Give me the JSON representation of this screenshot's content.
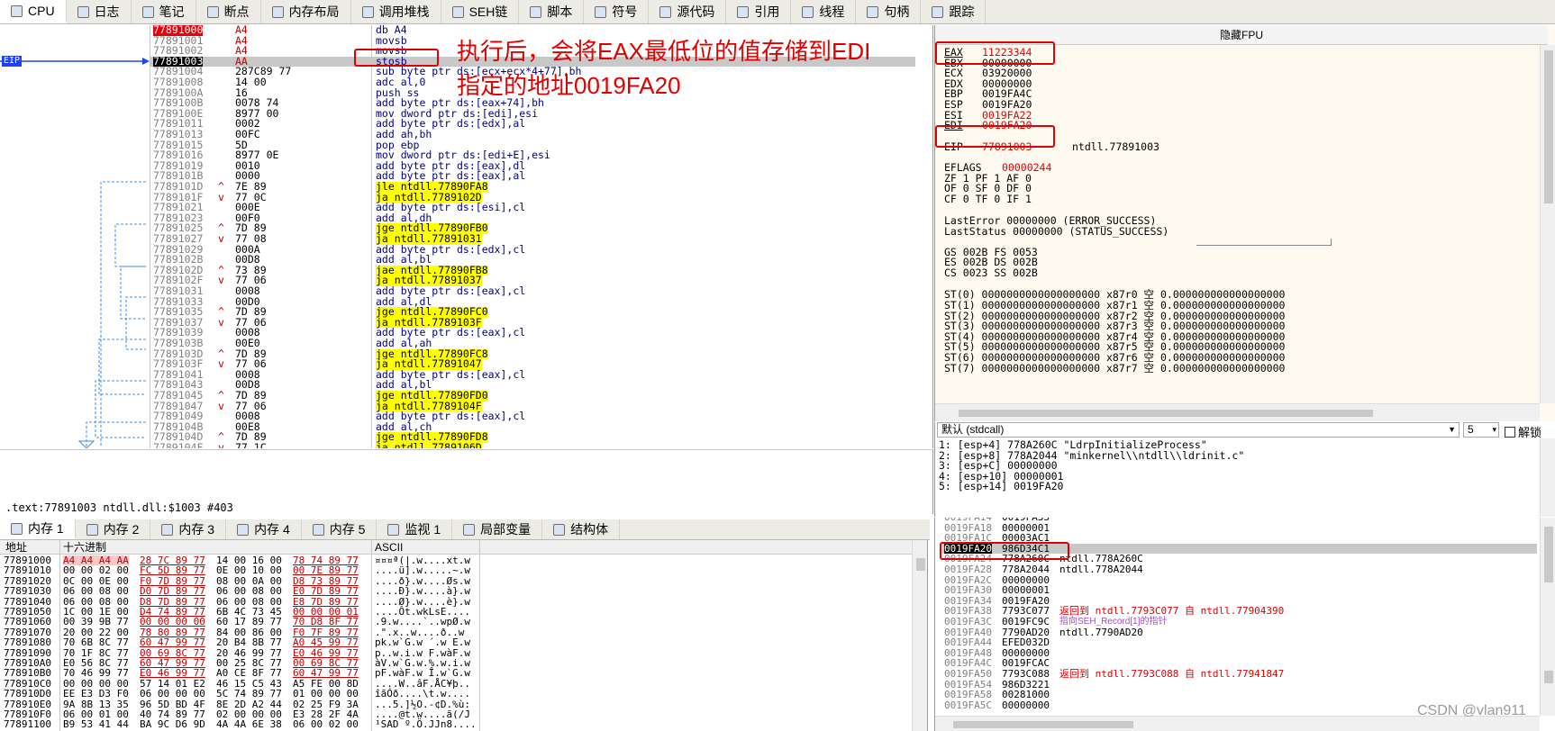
{
  "top_tabs": [
    {
      "label": "CPU",
      "icon": "cpu-icon",
      "active": true
    },
    {
      "label": "日志",
      "icon": "log-icon"
    },
    {
      "label": "笔记",
      "icon": "notes-icon"
    },
    {
      "label": "断点",
      "icon": "breakpoint-icon"
    },
    {
      "label": "内存布局",
      "icon": "memory-map-icon"
    },
    {
      "label": "调用堆栈",
      "icon": "call-stack-icon"
    },
    {
      "label": "SEH链",
      "icon": "seh-icon"
    },
    {
      "label": "脚本",
      "icon": "script-icon"
    },
    {
      "label": "符号",
      "icon": "symbols-icon"
    },
    {
      "label": "源代码",
      "icon": "source-icon"
    },
    {
      "label": "引用",
      "icon": "references-icon"
    },
    {
      "label": "线程",
      "icon": "threads-icon"
    },
    {
      "label": "句柄",
      "icon": "handles-icon"
    },
    {
      "label": "跟踪",
      "icon": "trace-icon"
    }
  ],
  "annotation": {
    "line1": "执行后，会将EAX最低位的值存储到EDI",
    "line2": "指定的地址0019FA20"
  },
  "eip_label": "EIP",
  "disasm": [
    {
      "addr": "77891000",
      "bytes": "A4",
      "instr": "db A4",
      "addr_style": "red",
      "bytes_red": true
    },
    {
      "addr": "77891001",
      "bytes": "A4",
      "instr": "movsb",
      "bytes_red": true
    },
    {
      "addr": "77891002",
      "bytes": "A4",
      "instr": "movsb",
      "bytes_red": true
    },
    {
      "addr": "77891003",
      "bytes": "AA",
      "instr": "stosb",
      "current": true,
      "bytes_red": true
    },
    {
      "addr": "77891004",
      "bytes": "287C89 77",
      "instr": "sub byte ptr ds:[ecx+ecx*4+77],bh"
    },
    {
      "addr": "77891008",
      "bytes": "14 00",
      "instr": "adc al,0"
    },
    {
      "addr": "7789100A",
      "bytes": "16",
      "instr": "push ss"
    },
    {
      "addr": "7789100B",
      "bytes": "0078 74",
      "instr": "add byte ptr ds:[eax+74],bh"
    },
    {
      "addr": "7789100E",
      "bytes": "8977 00",
      "instr": "mov dword ptr ds:[edi],esi"
    },
    {
      "addr": "77891011",
      "bytes": "0002",
      "instr": "add byte ptr ds:[edx],al"
    },
    {
      "addr": "77891013",
      "bytes": "00FC",
      "instr": "add ah,bh"
    },
    {
      "addr": "77891015",
      "bytes": "5D",
      "instr": "pop ebp"
    },
    {
      "addr": "77891016",
      "bytes": "8977 0E",
      "instr": "mov dword ptr ds:[edi+E],esi"
    },
    {
      "addr": "77891019",
      "bytes": "0010",
      "instr": "add byte ptr ds:[eax],dl"
    },
    {
      "addr": "7789101B",
      "bytes": "0000",
      "instr": "add byte ptr ds:[eax],al"
    },
    {
      "addr": "7789101D",
      "bytes": "7E 89",
      "instr": "jle ntdll.77890FA8",
      "jump": true,
      "arrow": "^"
    },
    {
      "addr": "7789101F",
      "bytes": "77 0C",
      "instr": "ja ntdll.7789102D",
      "jump": true,
      "arrow": "v"
    },
    {
      "addr": "77891021",
      "bytes": "000E",
      "instr": "add byte ptr ds:[esi],cl"
    },
    {
      "addr": "77891023",
      "bytes": "00F0",
      "instr": "add al,dh"
    },
    {
      "addr": "77891025",
      "bytes": "7D 89",
      "instr": "jge ntdll.77890FB0",
      "jump": true,
      "arrow": "^"
    },
    {
      "addr": "77891027",
      "bytes": "77 08",
      "instr": "ja ntdll.77891031",
      "jump": true,
      "arrow": "v"
    },
    {
      "addr": "77891029",
      "bytes": "000A",
      "instr": "add byte ptr ds:[edx],cl"
    },
    {
      "addr": "7789102B",
      "bytes": "00D8",
      "instr": "add al,bl"
    },
    {
      "addr": "7789102D",
      "bytes": "73 89",
      "instr": "jae ntdll.77890FB8",
      "jump": true,
      "arrow": "^"
    },
    {
      "addr": "7789102F",
      "bytes": "77 06",
      "instr": "ja ntdll.77891037",
      "jump": true,
      "arrow": "v"
    },
    {
      "addr": "77891031",
      "bytes": "0008",
      "instr": "add byte ptr ds:[eax],cl"
    },
    {
      "addr": "77891033",
      "bytes": "00D0",
      "instr": "add al,dl"
    },
    {
      "addr": "77891035",
      "bytes": "7D 89",
      "instr": "jge ntdll.77890FC0",
      "jump": true,
      "arrow": "^"
    },
    {
      "addr": "77891037",
      "bytes": "77 06",
      "instr": "ja ntdll.7789103F",
      "jump": true,
      "arrow": "v"
    },
    {
      "addr": "77891039",
      "bytes": "0008",
      "instr": "add byte ptr ds:[eax],cl"
    },
    {
      "addr": "7789103B",
      "bytes": "00E0",
      "instr": "add al,ah"
    },
    {
      "addr": "7789103D",
      "bytes": "7D 89",
      "instr": "jge ntdll.77890FC8",
      "jump": true,
      "arrow": "^"
    },
    {
      "addr": "7789103F",
      "bytes": "77 06",
      "instr": "ja ntdll.77891047",
      "jump": true,
      "arrow": "v"
    },
    {
      "addr": "77891041",
      "bytes": "0008",
      "instr": "add byte ptr ds:[eax],cl"
    },
    {
      "addr": "77891043",
      "bytes": "00D8",
      "instr": "add al,bl"
    },
    {
      "addr": "77891045",
      "bytes": "7D 89",
      "instr": "jge ntdll.77890FD0",
      "jump": true,
      "arrow": "^"
    },
    {
      "addr": "77891047",
      "bytes": "77 06",
      "instr": "ja ntdll.7789104F",
      "jump": true,
      "arrow": "v"
    },
    {
      "addr": "77891049",
      "bytes": "0008",
      "instr": "add byte ptr ds:[eax],cl"
    },
    {
      "addr": "7789104B",
      "bytes": "00E8",
      "instr": "add al,ch"
    },
    {
      "addr": "7789104D",
      "bytes": "7D 89",
      "instr": "jge ntdll.77890FD8",
      "jump": true,
      "arrow": "^"
    },
    {
      "addr": "7789104F",
      "bytes": "77 1C",
      "instr": "ja ntdll.7789106D",
      "jump": true,
      "arrow": "v"
    }
  ],
  "status_line": ".text:77891003 ntdll.dll:$1003 #403",
  "fpu_header": "隐藏FPU",
  "registers": [
    {
      "name": "EAX",
      "value": "11223344",
      "changed": true
    },
    {
      "name": "EBX",
      "value": "00000000"
    },
    {
      "name": "ECX",
      "value": "03920000"
    },
    {
      "name": "EDX",
      "value": "00000000"
    },
    {
      "name": "EBP",
      "value": "0019FA4C"
    },
    {
      "name": "ESP",
      "value": "0019FA20"
    },
    {
      "name": "ESI",
      "value": "0019FA22",
      "changed": true
    },
    {
      "name": "EDI",
      "value": "0019FA20",
      "changed": true
    }
  ],
  "eip_reg": {
    "name": "EIP",
    "value": "77891003",
    "comment": "ntdll.77891003"
  },
  "eflags": {
    "name": "EFLAGS",
    "value": "00000244"
  },
  "flags_lines": [
    "ZF 1  PF 1  AF 0",
    "OF 0  SF 0  DF 0",
    "CF 0  TF 0  IF 1"
  ],
  "last_error": "LastError  00000000 (ERROR_SUCCESS)",
  "last_status": "LastStatus 00000000 (STATUS_SUCCESS)",
  "segments": [
    "GS 002B  FS 0053",
    "ES 002B  DS 002B",
    "CS 0023  SS 002B"
  ],
  "fpu": [
    "ST(0) 0000000000000000000 x87r0 空 0.000000000000000000",
    "ST(1) 0000000000000000000 x87r1 空 0.000000000000000000",
    "ST(2) 0000000000000000000 x87r2 空 0.000000000000000000",
    "ST(3) 0000000000000000000 x87r3 空 0.000000000000000000",
    "ST(4) 0000000000000000000 x87r4 空 0.000000000000000000",
    "ST(5) 0000000000000000000 x87r5 空 0.000000000000000000",
    "ST(6) 0000000000000000000 x87r6 空 0.000000000000000000",
    "ST(7) 0000000000000000000 x87r7 空 0.000000000000000000"
  ],
  "callconv": {
    "label": "默认 (stdcall)",
    "count": "5",
    "unlock_label": "解锁"
  },
  "params": [
    "1: [esp+4] 778A260C \"LdrpInitializeProcess\"",
    "2: [esp+8] 778A2044 \"minkernel\\\\ntdll\\\\ldrinit.c\"",
    "3: [esp+C] 00000000",
    "4: [esp+10] 00000001",
    "5: [esp+14] 0019FA20"
  ],
  "mem_tabs": [
    {
      "label": "内存 1",
      "icon": "memory-icon",
      "active": true
    },
    {
      "label": "内存 2",
      "icon": "memory-icon"
    },
    {
      "label": "内存 3",
      "icon": "memory-icon"
    },
    {
      "label": "内存 4",
      "icon": "memory-icon"
    },
    {
      "label": "内存 5",
      "icon": "memory-icon"
    },
    {
      "label": "监视 1",
      "icon": "watch-icon"
    },
    {
      "label": "局部变量",
      "icon": "locals-icon"
    },
    {
      "label": "结构体",
      "icon": "struct-icon"
    }
  ],
  "mem_headers": {
    "addr": "地址",
    "hex": "十六进制",
    "ascii": "ASCII"
  },
  "mem_rows": [
    {
      "addr": "77891000",
      "hex": [
        "A4 A4 A4 AA",
        "28 7C 89 77",
        "14 00 16 00",
        "78 74 89 77"
      ],
      "ascii": "¤¤¤ª(|.w....xt.w"
    },
    {
      "addr": "77891010",
      "hex": [
        "00 00 02 00",
        "FC 5D 89 77",
        "0E 00 10 00",
        "00 7E 89 77"
      ],
      "ascii": "....ü].w.....~.w"
    },
    {
      "addr": "77891020",
      "hex": [
        "0C 00 0E 00",
        "F0 7D 89 77",
        "08 00 0A 00",
        "D8 73 89 77"
      ],
      "ascii": "....ð}.w....Øs.w"
    },
    {
      "addr": "77891030",
      "hex": [
        "06 00 08 00",
        "D0 7D 89 77",
        "06 00 08 00",
        "E0 7D 89 77"
      ],
      "ascii": "....Ð}.w....à}.w"
    },
    {
      "addr": "77891040",
      "hex": [
        "06 00 08 00",
        "D8 7D 89 77",
        "06 00 08 00",
        "E8 7D 89 77"
      ],
      "ascii": "....Ø}.w....è}.w"
    },
    {
      "addr": "77891050",
      "hex": [
        "1C 00 1E 00",
        "D4 74 89 77",
        "6B 4C 73 45",
        "00 00 00 01"
      ],
      "ascii": "....Ôt.wkLsE...."
    },
    {
      "addr": "77891060",
      "hex": [
        "00 39 9B 77",
        "00 00 00 00",
        "60 17 89 77",
        "70 D8 8F 77"
      ],
      "ascii": ".9.w....`..wpØ.w"
    },
    {
      "addr": "77891070",
      "hex": [
        "20 00 22 00",
        "78 80 89 77",
        "84 00 86 00",
        "F0 7F 89 77"
      ],
      "ascii": " .\".x..w....ð..w"
    },
    {
      "addr": "77891080",
      "hex": [
        "70 6B 8C 77",
        "60 47 99 77",
        "20 B4 8B 77",
        "A0 45 99 77"
      ],
      "ascii": "pk.w`G.w ´.w E.w"
    },
    {
      "addr": "77891090",
      "hex": [
        "70 1F 8C 77",
        "00 69 8C 77",
        "20 46 99 77",
        "E0 46 99 77"
      ],
      "ascii": "p..w.i.w F.wàF.w"
    },
    {
      "addr": "778910A0",
      "hex": [
        "E0 56 8C 77",
        "60 47 99 77",
        "00 25 8C 77",
        "00 69 8C 77"
      ],
      "ascii": "àV.w`G.w.%.w.i.w"
    },
    {
      "addr": "778910B0",
      "hex": [
        "70 46 99 77",
        "E0 46 99 77",
        "A0 CE 8F 77",
        "60 47 99 77"
      ],
      "ascii": "pF.wàF.w Î.w`G.w"
    },
    {
      "addr": "778910C0",
      "hex": [
        "00 00 00 00",
        "57 14 01 E2",
        "46 15 C5 43",
        "A5 FE 00 8D"
      ],
      "ascii": "....W..âF.ÅC¥þ.."
    },
    {
      "addr": "778910D0",
      "hex": [
        "EE E3 D3 F0",
        "06 00 00 00",
        "5C 74 89 77",
        "01 00 00 00"
      ],
      "ascii": "îãÓð....\\t.w...."
    },
    {
      "addr": "778910E0",
      "hex": [
        "9A 8B 13 35",
        "96 5D BD 4F",
        "8E 2D A2 44",
        "02 25 F9 3A"
      ],
      "ascii": "...5.]½O.-¢D.%ù:"
    },
    {
      "addr": "778910F0",
      "hex": [
        "06 00 01 00",
        "40 74 89 77",
        "02 00 00 00",
        "E3 28 2F 4A"
      ],
      "ascii": "....@t.w....ã(/J"
    },
    {
      "addr": "77891100",
      "hex": [
        "B9 53 41 44",
        "BA 9C D6 9D",
        "4A 4A 6E 38",
        "06 00 02 00"
      ],
      "ascii": "¹SAD º.Ö.JJn8...."
    }
  ],
  "stack_rows": [
    {
      "addr": "0019FA14",
      "value": "0019FA33",
      "comment": ""
    },
    {
      "addr": "0019FA18",
      "value": "00000001",
      "comment": ""
    },
    {
      "addr": "0019FA1C",
      "value": "00003AC1",
      "comment": ""
    },
    {
      "addr": "0019FA20",
      "value": "986D34C1",
      "comment": "",
      "current": true
    },
    {
      "addr": "0019FA24",
      "value": "778A260C",
      "comment": "ntdll.778A260C"
    },
    {
      "addr": "0019FA28",
      "value": "778A2044",
      "comment": "ntdll.778A2044"
    },
    {
      "addr": "0019FA2C",
      "value": "00000000",
      "comment": ""
    },
    {
      "addr": "0019FA30",
      "value": "00000001",
      "comment": ""
    },
    {
      "addr": "0019FA34",
      "value": "0019FA20",
      "comment": ""
    },
    {
      "addr": "0019FA38",
      "value": "7793C077",
      "comment": "返回到 ntdll.7793C077 自 ntdll.77904390",
      "ret": true
    },
    {
      "addr": "0019FA3C",
      "value": "0019FC9C",
      "comment": "指向SEH_Record[1]的指针",
      "seh": true
    },
    {
      "addr": "0019FA40",
      "value": "7790AD20",
      "comment": "ntdll.7790AD20"
    },
    {
      "addr": "0019FA44",
      "value": "EFED032D",
      "comment": ""
    },
    {
      "addr": "0019FA48",
      "value": "00000000",
      "comment": ""
    },
    {
      "addr": "0019FA4C",
      "value": "0019FCAC",
      "comment": ""
    },
    {
      "addr": "0019FA50",
      "value": "7793C088",
      "comment": "返回到 ntdll.7793C088 自 ntdll.77941847",
      "ret": true
    },
    {
      "addr": "0019FA54",
      "value": "986D3221",
      "comment": ""
    },
    {
      "addr": "0019FA58",
      "value": "00281000",
      "comment": ""
    },
    {
      "addr": "0019FA5C",
      "value": "00000000",
      "comment": ""
    }
  ],
  "watermark": "CSDN @vlan911"
}
